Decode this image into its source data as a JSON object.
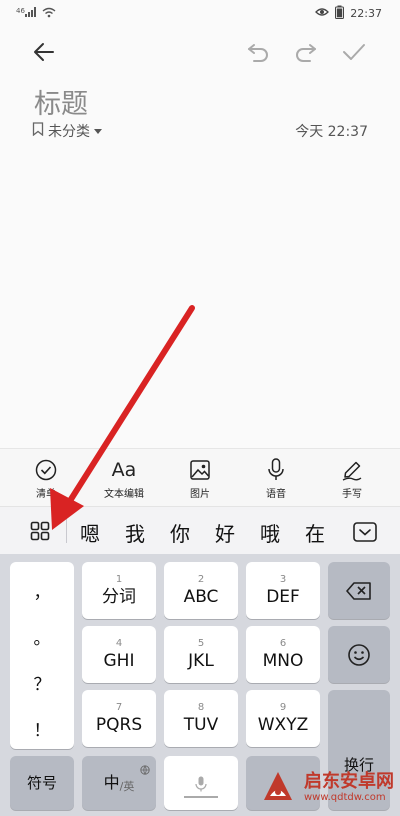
{
  "status_bar": {
    "time": "22:37",
    "signal_prefix": "ᵃˡ"
  },
  "toolbar": {
    "icons": [
      "back-arrow-icon",
      "undo-icon",
      "redo-icon",
      "checkmark-icon"
    ]
  },
  "note": {
    "title": "标题",
    "category": "未分类",
    "timestamp": "今天 22:37"
  },
  "format_bar": {
    "items": [
      {
        "label": "清单",
        "icon": "checklist-icon"
      },
      {
        "label": "文本编辑",
        "icon": "text-format-icon",
        "glyph": "Aa"
      },
      {
        "label": "图片",
        "icon": "image-icon"
      },
      {
        "label": "语音",
        "icon": "microphone-icon"
      },
      {
        "label": "手写",
        "icon": "pen-icon"
      }
    ]
  },
  "candidates": [
    "嗯",
    "我",
    "你",
    "好",
    "哦",
    "在"
  ],
  "keyboard": {
    "punctuation": [
      "，",
      "。",
      "？",
      "！"
    ],
    "row1": [
      {
        "num": "1",
        "label": "分词"
      },
      {
        "num": "2",
        "label": "ABC"
      },
      {
        "num": "3",
        "label": "DEF"
      }
    ],
    "row2": [
      {
        "num": "4",
        "label": "GHI"
      },
      {
        "num": "5",
        "label": "JKL"
      },
      {
        "num": "6",
        "label": "MNO"
      }
    ],
    "row3": [
      {
        "num": "7",
        "label": "PQRS"
      },
      {
        "num": "8",
        "label": "TUV"
      },
      {
        "num": "9",
        "label": "WXYZ"
      }
    ],
    "enter_label": "换行",
    "symbol_label": "符号",
    "lang_main": "中",
    "lang_alt": "/英"
  },
  "watermark": {
    "title": "启东安卓网",
    "url": "www.qdtdw.com"
  },
  "colors": {
    "arrow": "#d92323",
    "keyboard_bg": "#d6d8de",
    "watermark": "#c0392b"
  }
}
